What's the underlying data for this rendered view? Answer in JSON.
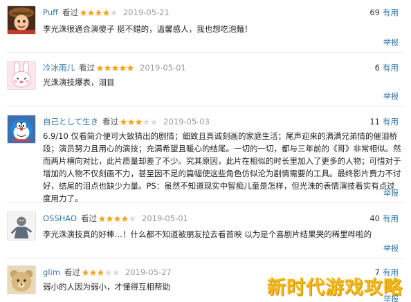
{
  "labels": {
    "seen": "看过",
    "useful": "有用",
    "report": "举报"
  },
  "colors": {
    "link": "#3377aa",
    "star": "#f5a623",
    "star_empty": "#dddddd",
    "watermark": "#f3b81a"
  },
  "reviews": [
    {
      "user": "Puff",
      "rating": 4,
      "date": "2019-05-21",
      "useful_count": "69",
      "text": "李光洙很適合演傻子 挺不錯的，溫馨感人，我也想吃泡麵！",
      "avatar": "woody-avatar"
    },
    {
      "user": "冷冰雨儿",
      "rating": 5,
      "date": "2019-05-01",
      "useful_count": "6",
      "text": "光洙演技爆表，泪目",
      "avatar": "bunny-avatar"
    },
    {
      "user": "自己として生き",
      "rating": 3,
      "date": "2019-05-03",
      "useful_count": "11",
      "text": "6.9/10 仅看简介便可大致猜出的剧情；细致且真诚刻画的家庭生活；尾声迎来的满满兄弟情的催泪桥段；演员努力且用心的演技；充满希望且暖心的结尾。一切的一切，都与三年前的《哥》非常相似。然而两片横向对比，此片质量却差了不少。究其原因，此片在相似的时长里加入了更多的人物；可惜对于增加的人物不仅刻画不力，甚至因不足的篇幅使这些角色仿似沦为剧情需要的工具。最终影片费力不讨好，结尾的泪点也缺少力量。PS：虽然不知道现实中智痴儿童是怎样，但光洙的表情演技着实有点过度用力了。",
      "avatar": "doraemon-avatar"
    },
    {
      "user": "OSSHAO",
      "rating": 4,
      "date": "2019-05-01",
      "useful_count": "40",
      "text": "李光洙演技真的好棒…！什么都不知道被朋友拉去看首映 以为是个喜剧片结果哭的稀里哗啦的",
      "avatar": "cartoon-avatar"
    },
    {
      "user": "glim",
      "rating": 3,
      "date": "2019-05-27",
      "useful_count": "7",
      "text": "弱小的人因为弱小，才懂得互相帮助",
      "avatar": "bear-avatar"
    }
  ],
  "watermark": "新时代游戏攻略"
}
